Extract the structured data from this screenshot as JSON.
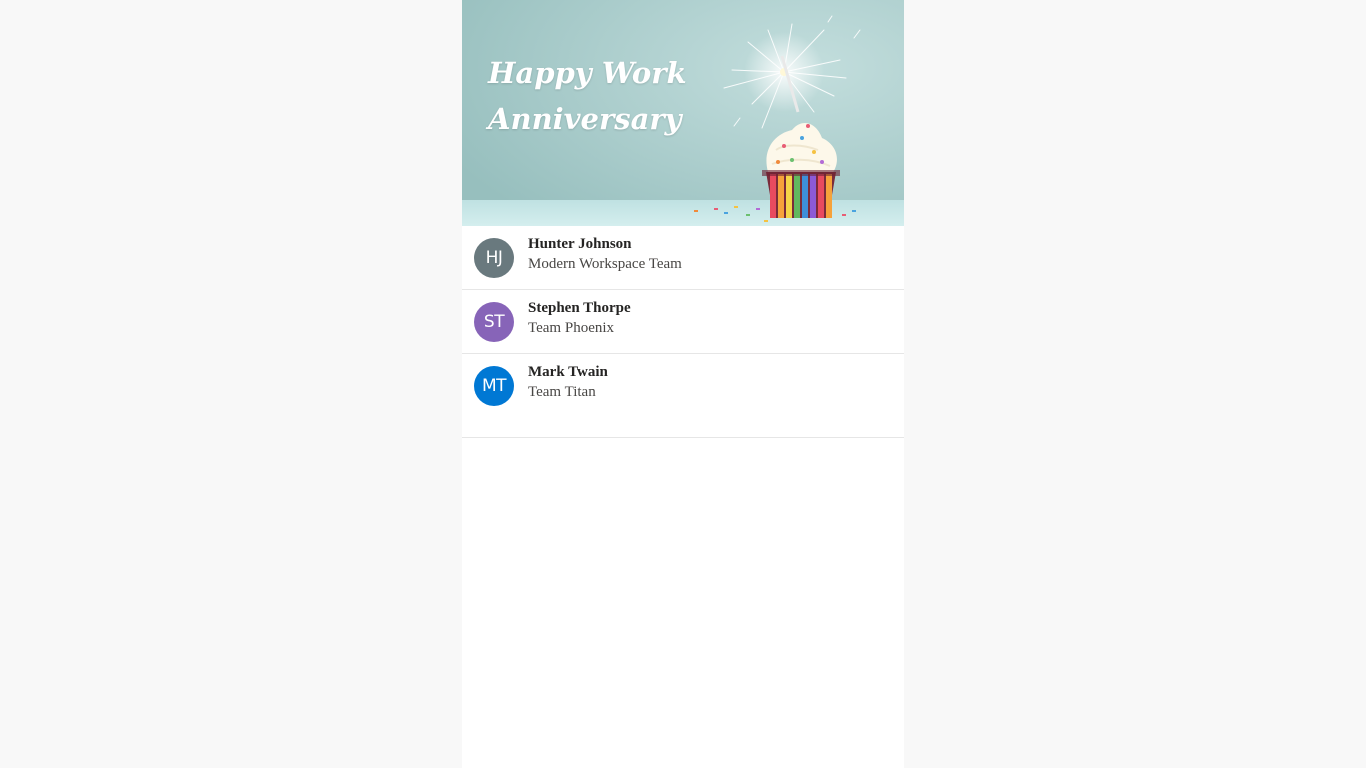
{
  "banner": {
    "title_line1": "Happy Work",
    "title_line2": "Anniversary"
  },
  "people": [
    {
      "initials": "HJ",
      "name": "Hunter Johnson",
      "team": "Modern Workspace Team",
      "avatar_color": "#69797e"
    },
    {
      "initials": "ST",
      "name": "Stephen Thorpe",
      "team": "Team Phoenix",
      "avatar_color": "#8764b8"
    },
    {
      "initials": "MT",
      "name": "Mark Twain",
      "team": "Team Titan",
      "avatar_color": "#0078d4"
    }
  ],
  "colors": {
    "page_background": "#f8f8f8",
    "card_background": "#ffffff",
    "banner_background": "#a9cccb"
  }
}
